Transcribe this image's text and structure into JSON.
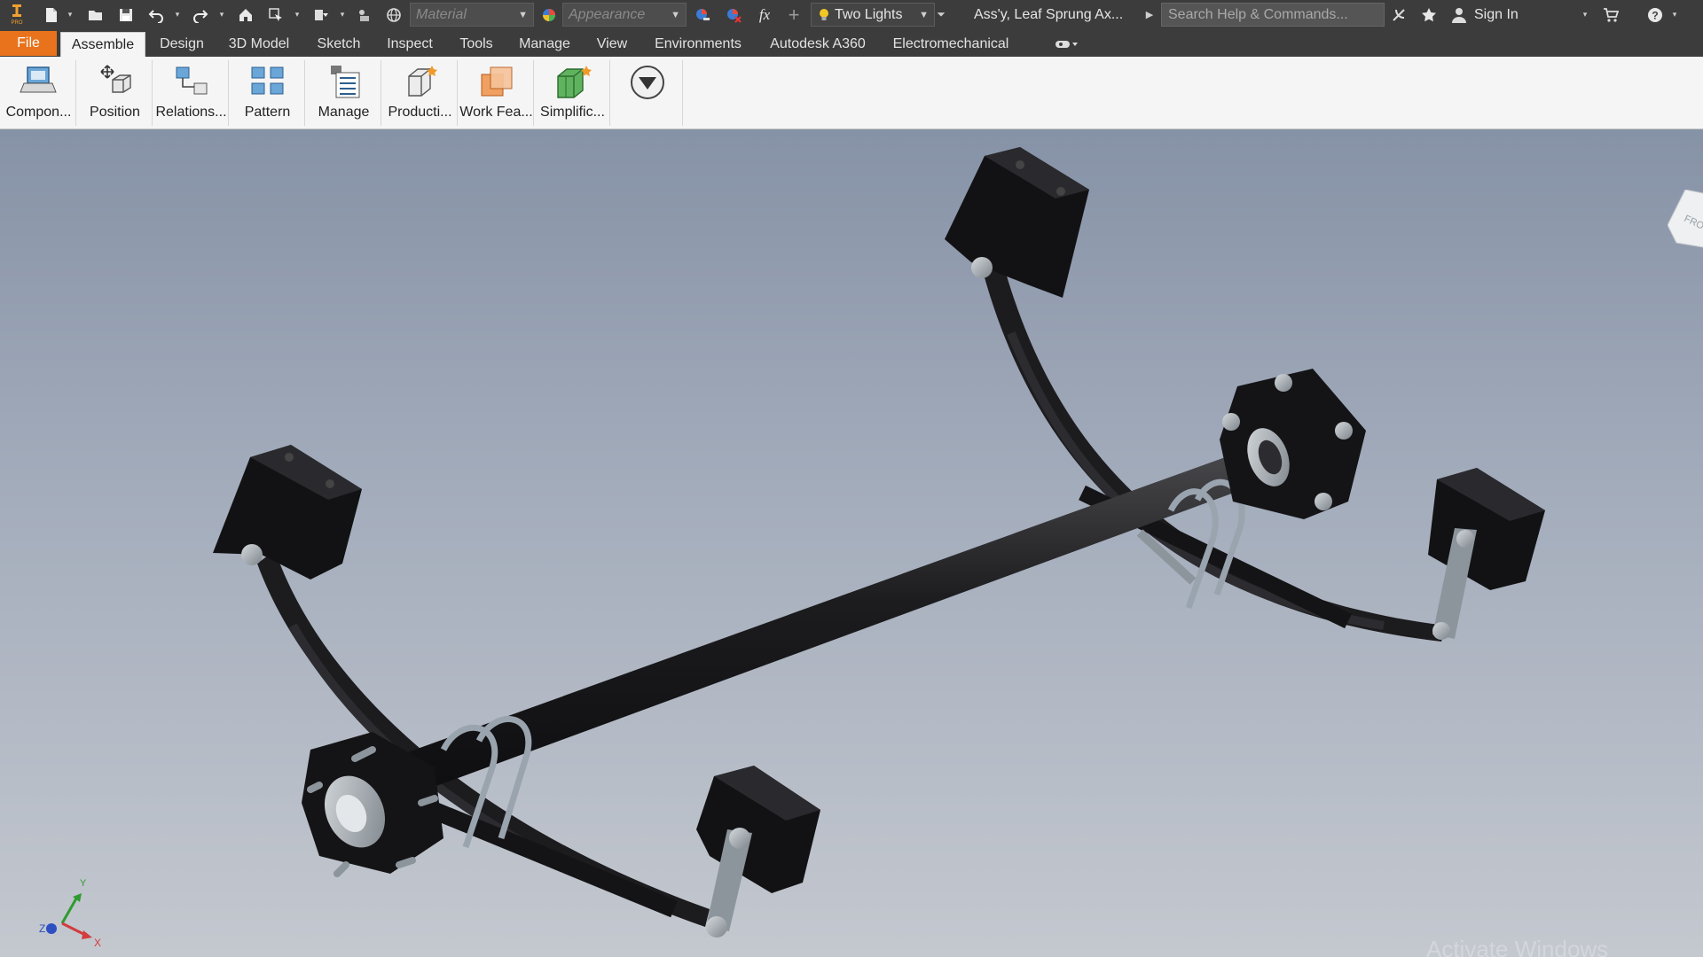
{
  "titlebar": {
    "app_logo_text": "PRO",
    "material_placeholder": "Material",
    "appearance_placeholder": "Appearance",
    "lighting": "Two Lights",
    "document_title": "Ass'y, Leaf Sprung Ax...",
    "search_placeholder": "Search Help & Commands...",
    "sign_in": "Sign In"
  },
  "tabs": [
    {
      "label": "File"
    },
    {
      "label": "Assemble"
    },
    {
      "label": "Design"
    },
    {
      "label": "3D Model"
    },
    {
      "label": "Sketch"
    },
    {
      "label": "Inspect"
    },
    {
      "label": "Tools"
    },
    {
      "label": "Manage"
    },
    {
      "label": "View"
    },
    {
      "label": "Environments"
    },
    {
      "label": "Autodesk A360"
    },
    {
      "label": "Electromechanical"
    }
  ],
  "active_tab": "Assemble",
  "ribbon": {
    "buttons": [
      {
        "label": "Compon..."
      },
      {
        "label": "Position"
      },
      {
        "label": "Relations..."
      },
      {
        "label": "Pattern"
      },
      {
        "label": "Manage"
      },
      {
        "label": "Producti..."
      },
      {
        "label": "Work Fea..."
      },
      {
        "label": "Simplific..."
      }
    ]
  },
  "viewport": {
    "model": "leaf-sprung-axle-assembly",
    "viewcube_label": "FRO",
    "axes": {
      "x": "X",
      "y": "Y",
      "z": "Z"
    },
    "watermark": "Activate Windows"
  },
  "colors": {
    "file_tab": "#e8731c",
    "toolbar_bg": "#3c3c3c",
    "ribbon_bg": "#f5f5f5",
    "viewport_top": "#8692a6",
    "viewport_bottom": "#c4c8cf",
    "model_dark": "#1c1c1e",
    "model_metal": "#8d959c"
  }
}
